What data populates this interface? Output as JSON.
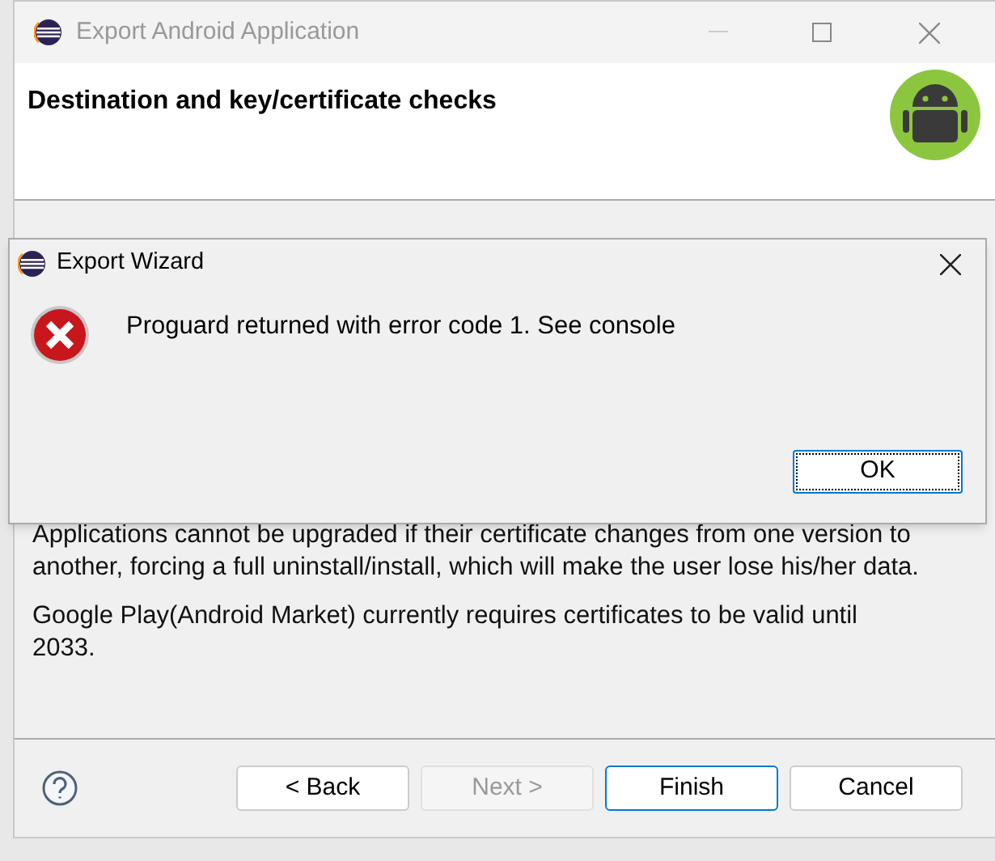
{
  "window": {
    "title": "Export Android Application",
    "header": "Destination and key/certificate checks"
  },
  "paragraphs": [
    "Applications cannot be upgraded if their certificate changes from one version to another, forcing a full uninstall/install, which will make the user lose his/her data.",
    "Google Play(Android Market) currently requires certificates to be valid until 2033."
  ],
  "buttons": [
    {
      "label": "< Back",
      "disabled": false,
      "default": false
    },
    {
      "label": "Next >",
      "disabled": true,
      "default": false
    },
    {
      "label": "Finish",
      "disabled": false,
      "default": true
    },
    {
      "label": "Cancel",
      "disabled": false,
      "default": false
    }
  ],
  "dialog": {
    "title": "Export Wizard",
    "message": "Proguard returned with error code 1. See console",
    "button": "OK"
  }
}
